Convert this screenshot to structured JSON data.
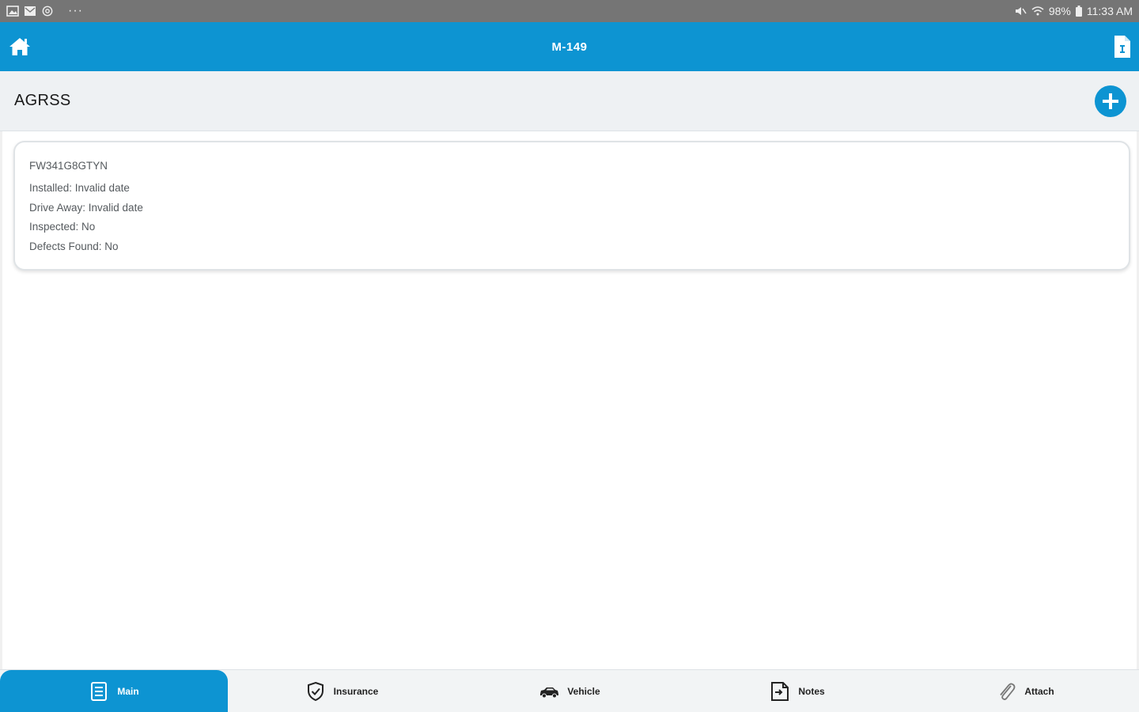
{
  "status_bar": {
    "indicators": "98%",
    "time": "11:33 AM",
    "overflow": "···"
  },
  "header": {
    "title": "M-149"
  },
  "section": {
    "title": "AGRSS"
  },
  "card": {
    "id": "FW341G8GTYN",
    "installed": "Installed: Invalid date",
    "drive_away": "Drive Away: Invalid date",
    "inspected": "Inspected: No",
    "defects_found": "Defects Found: No"
  },
  "nav": {
    "items": [
      {
        "label": "Main",
        "icon": "main-icon",
        "active": true
      },
      {
        "label": "Insurance",
        "icon": "shield-check-icon",
        "active": false
      },
      {
        "label": "Vehicle",
        "icon": "car-icon",
        "active": false
      },
      {
        "label": "Notes",
        "icon": "notes-icon",
        "active": false
      },
      {
        "label": "Attach",
        "icon": "paperclip-icon",
        "active": false
      }
    ]
  },
  "colors": {
    "primary": "#0d94d2",
    "status_bar": "#757575",
    "section_bg": "#eef1f3"
  }
}
